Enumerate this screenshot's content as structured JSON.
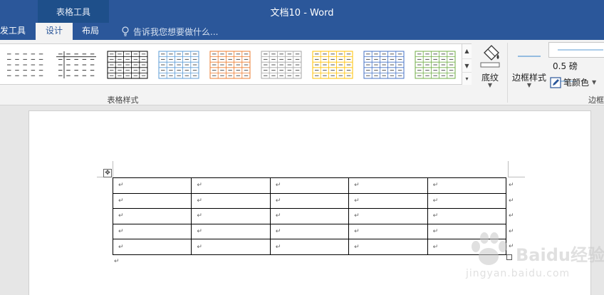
{
  "titlebar": {
    "context_group": "表格工具",
    "doc_title": "文档10 - Word"
  },
  "tabs": {
    "dev": "发工具",
    "design": "设计",
    "layout": "布局",
    "tell_me": "告诉我您想要做什么..."
  },
  "ribbon": {
    "table_styles_label": "表格样式",
    "shading_label": "底纹",
    "border_styles_label": "边框样式",
    "line_weight": "0.5 磅",
    "pen_color": "笔颜色",
    "borders_group_label": "边框",
    "gallery_styles": [
      {
        "name": "plain-table",
        "color": "#444444"
      },
      {
        "name": "table-grid-light",
        "color": "#333333"
      },
      {
        "name": "table-grid",
        "color": "#000000"
      },
      {
        "name": "grid-blue",
        "color": "#5b9bd5"
      },
      {
        "name": "grid-orange",
        "color": "#ed7d31"
      },
      {
        "name": "grid-gray",
        "color": "#a5a5a5"
      },
      {
        "name": "grid-gold",
        "color": "#ffc000"
      },
      {
        "name": "grid-dark-blue",
        "color": "#4472c4"
      },
      {
        "name": "grid-green",
        "color": "#70ad47"
      }
    ]
  },
  "document": {
    "table": {
      "rows": 5,
      "cols": 5,
      "cell_mark": "↵"
    },
    "end_mark": "↵"
  },
  "watermark": {
    "brand": "Baidu",
    "brand_cn": "经验",
    "url": "jingyan.baidu.com"
  },
  "colors": {
    "accent": "#2b579a",
    "ribbon_bg": "#f3f3f3"
  }
}
